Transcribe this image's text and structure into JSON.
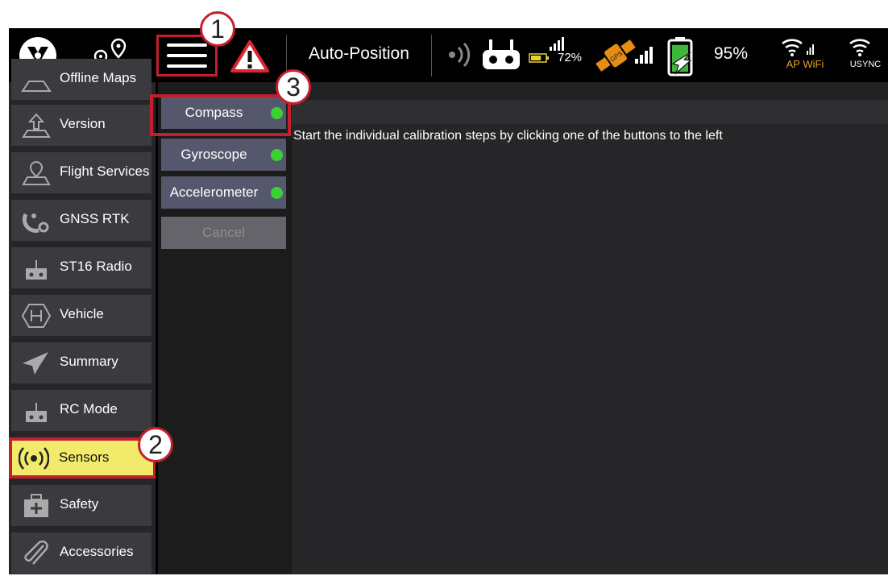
{
  "topbar": {
    "flight_mode": "Auto-Position",
    "rc_battery_percent": "72%",
    "rc_battery_level": 0.72,
    "drone_battery_percent": "95%",
    "drone_battery_level": 0.95,
    "ap_wifi_label": "AP WiFi",
    "usync_label": "USYNC",
    "icons": [
      "logo-icon",
      "plan-route-icon",
      "menu-icon",
      "warning-icon",
      "signal-icon",
      "remote-controller-icon",
      "gps-icon",
      "battery-icon",
      "wifi-icon"
    ]
  },
  "sidebar": {
    "items": [
      {
        "label": "Offline Maps",
        "icon": "map-icon"
      },
      {
        "label": "Version",
        "icon": "upload-icon"
      },
      {
        "label": "Flight Services",
        "icon": "location-map-icon"
      },
      {
        "label": "GNSS RTK",
        "icon": "satellite-gear-icon"
      },
      {
        "label": "ST16 Radio",
        "icon": "radio-icon"
      },
      {
        "label": "Vehicle",
        "icon": "hexagon-h-icon"
      },
      {
        "label": "Summary",
        "icon": "paper-plane-icon"
      },
      {
        "label": "RC Mode",
        "icon": "radio-icon"
      },
      {
        "label": "Sensors",
        "icon": "broadcast-icon"
      },
      {
        "label": "Safety",
        "icon": "first-aid-icon"
      },
      {
        "label": "Accessories",
        "icon": "paperclip-icon"
      }
    ],
    "active": "Sensors"
  },
  "calibration": {
    "buttons": [
      {
        "label": "Compass",
        "status": "ok"
      },
      {
        "label": "Gyroscope",
        "status": "ok"
      },
      {
        "label": "Accelerometer",
        "status": "ok"
      }
    ],
    "cancel_label": "Cancel"
  },
  "content": {
    "instructions": "Start the individual calibration steps by clicking one of the buttons to the left"
  },
  "callouts": [
    "1",
    "2",
    "3"
  ],
  "colors": {
    "highlight": "#c41f2c",
    "active_item": "#f1ea6a",
    "status_ok": "#3cd034",
    "ap_wifi": "#e8a020"
  }
}
